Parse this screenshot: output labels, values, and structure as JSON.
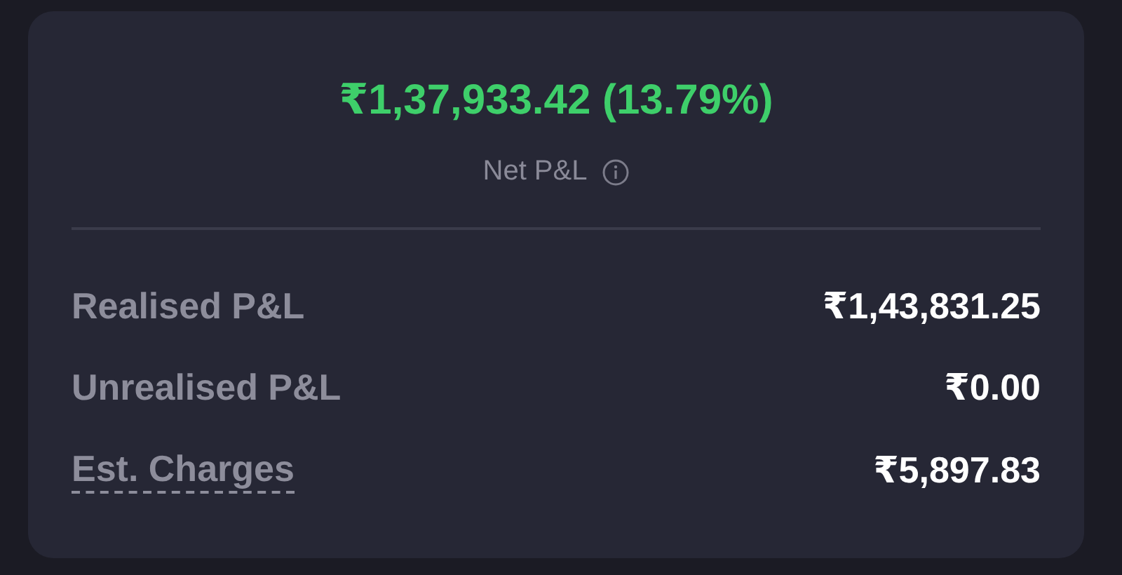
{
  "net_pnl": {
    "value": "₹1,37,933.42 (13.79%)",
    "label": "Net P&L"
  },
  "rows": [
    {
      "label": "Realised P&L",
      "value": "₹1,43,831.25",
      "kind": "plain"
    },
    {
      "label": "Unrealised P&L",
      "value": "₹0.00",
      "kind": "plain"
    },
    {
      "label": "Est. Charges",
      "value": "₹5,897.83",
      "kind": "hint"
    }
  ]
}
